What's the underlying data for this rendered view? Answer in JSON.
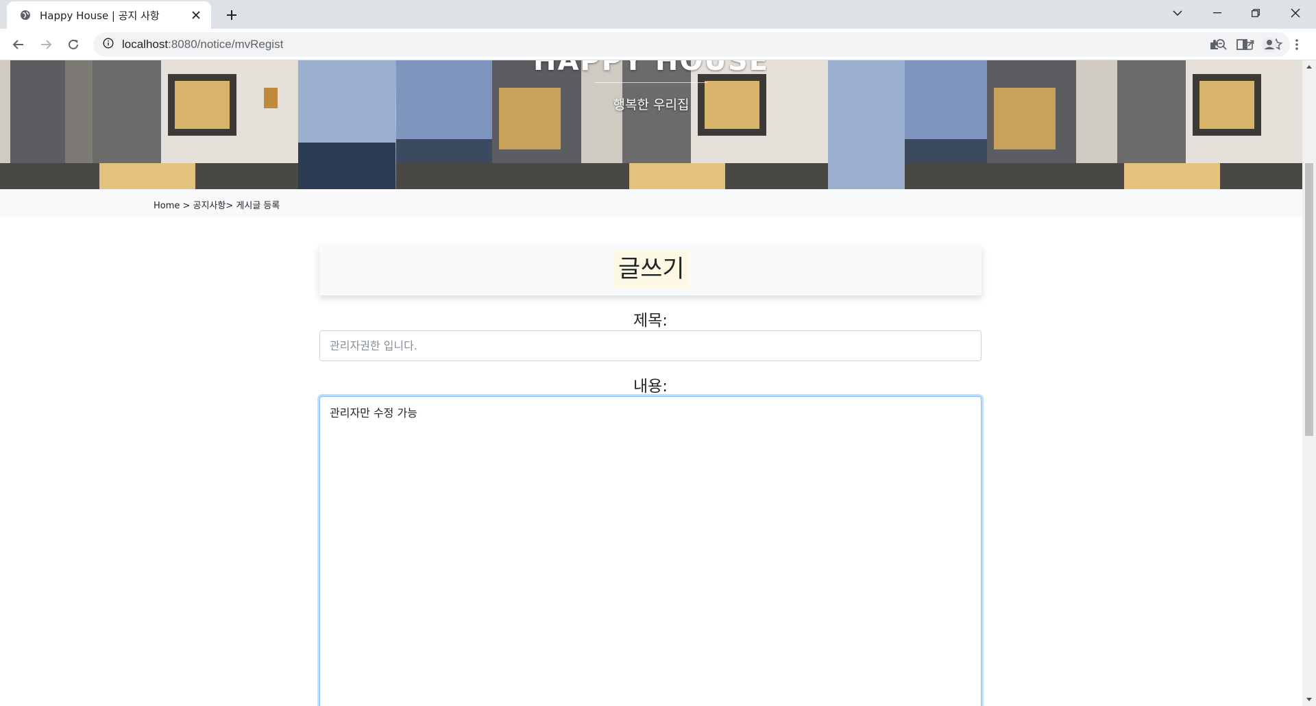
{
  "browser": {
    "tab_title": "Happy House | 공지 사항",
    "url_host": "localhost",
    "url_path": ":8080/notice/mvRegist"
  },
  "hero": {
    "title": "HAPPY HOUSE",
    "subtitle": "행복한 우리집"
  },
  "breadcrumb": {
    "text": "Home > 공지사항> 게시글 등록"
  },
  "form": {
    "heading": "글쓰기",
    "title_label": "제목:",
    "title_placeholder": "관리자권한 입니다.",
    "content_label": "내용:",
    "content_value": "관리자만 수정 가능"
  },
  "colors": {
    "accent_focus": "#80bdff",
    "heading_highlight": "#fcf8e3",
    "breadcrumb_bg": "#f8f9fa"
  }
}
